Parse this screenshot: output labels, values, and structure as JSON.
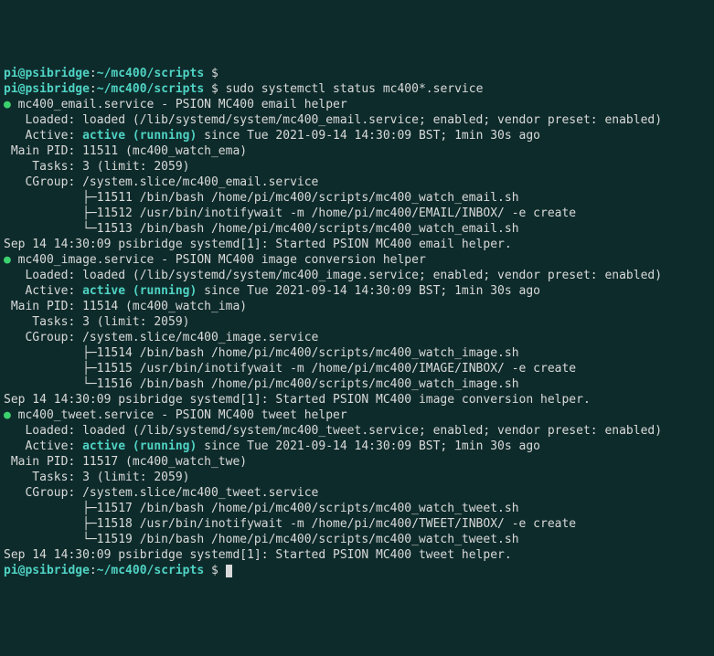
{
  "prompt": {
    "user": "pi@psibridge",
    "sep1": ":",
    "path": "~/mc400/scripts",
    "dollar": " $ "
  },
  "cmd": "sudo systemctl status mc400*.service",
  "svc": [
    {
      "bullet": "●",
      "header": " mc400_email.service - PSION MC400 email helper",
      "loaded": "   Loaded: loaded (/lib/systemd/system/mc400_email.service; enabled; vendor preset: enabled)",
      "active_pre": "   Active: ",
      "active_green": "active (running)",
      "active_post": " since Tue 2021-09-14 14:30:09 BST; 1min 30s ago",
      "pid": " Main PID: 11511 (mc400_watch_ema)",
      "tasks": "    Tasks: 3 (limit: 2059)",
      "cgroup": "   CGroup: /system.slice/mc400_email.service",
      "p1": "           ├─11511 /bin/bash /home/pi/mc400/scripts/mc400_watch_email.sh",
      "p2": "           ├─11512 /usr/bin/inotifywait -m /home/pi/mc400/EMAIL/INBOX/ -e create",
      "p3": "           └─11513 /bin/bash /home/pi/mc400/scripts/mc400_watch_email.sh",
      "blank": "",
      "log": "Sep 14 14:30:09 psibridge systemd[1]: Started PSION MC400 email helper."
    },
    {
      "bullet": "●",
      "header": " mc400_image.service - PSION MC400 image conversion helper",
      "loaded": "   Loaded: loaded (/lib/systemd/system/mc400_image.service; enabled; vendor preset: enabled)",
      "active_pre": "   Active: ",
      "active_green": "active (running)",
      "active_post": " since Tue 2021-09-14 14:30:09 BST; 1min 30s ago",
      "pid": " Main PID: 11514 (mc400_watch_ima)",
      "tasks": "    Tasks: 3 (limit: 2059)",
      "cgroup": "   CGroup: /system.slice/mc400_image.service",
      "p1": "           ├─11514 /bin/bash /home/pi/mc400/scripts/mc400_watch_image.sh",
      "p2": "           ├─11515 /usr/bin/inotifywait -m /home/pi/mc400/IMAGE/INBOX/ -e create",
      "p3": "           └─11516 /bin/bash /home/pi/mc400/scripts/mc400_watch_image.sh",
      "blank": "",
      "log": "Sep 14 14:30:09 psibridge systemd[1]: Started PSION MC400 image conversion helper."
    },
    {
      "bullet": "●",
      "header": " mc400_tweet.service - PSION MC400 tweet helper",
      "loaded": "   Loaded: loaded (/lib/systemd/system/mc400_tweet.service; enabled; vendor preset: enabled)",
      "active_pre": "   Active: ",
      "active_green": "active (running)",
      "active_post": " since Tue 2021-09-14 14:30:09 BST; 1min 30s ago",
      "pid": " Main PID: 11517 (mc400_watch_twe)",
      "tasks": "    Tasks: 3 (limit: 2059)",
      "cgroup": "   CGroup: /system.slice/mc400_tweet.service",
      "p1": "           ├─11517 /bin/bash /home/pi/mc400/scripts/mc400_watch_tweet.sh",
      "p2": "           ├─11518 /usr/bin/inotifywait -m /home/pi/mc400/TWEET/INBOX/ -e create",
      "p3": "           └─11519 /bin/bash /home/pi/mc400/scripts/mc400_watch_tweet.sh",
      "blank": "",
      "log": "Sep 14 14:30:09 psibridge systemd[1]: Started PSION MC400 tweet helper."
    }
  ]
}
